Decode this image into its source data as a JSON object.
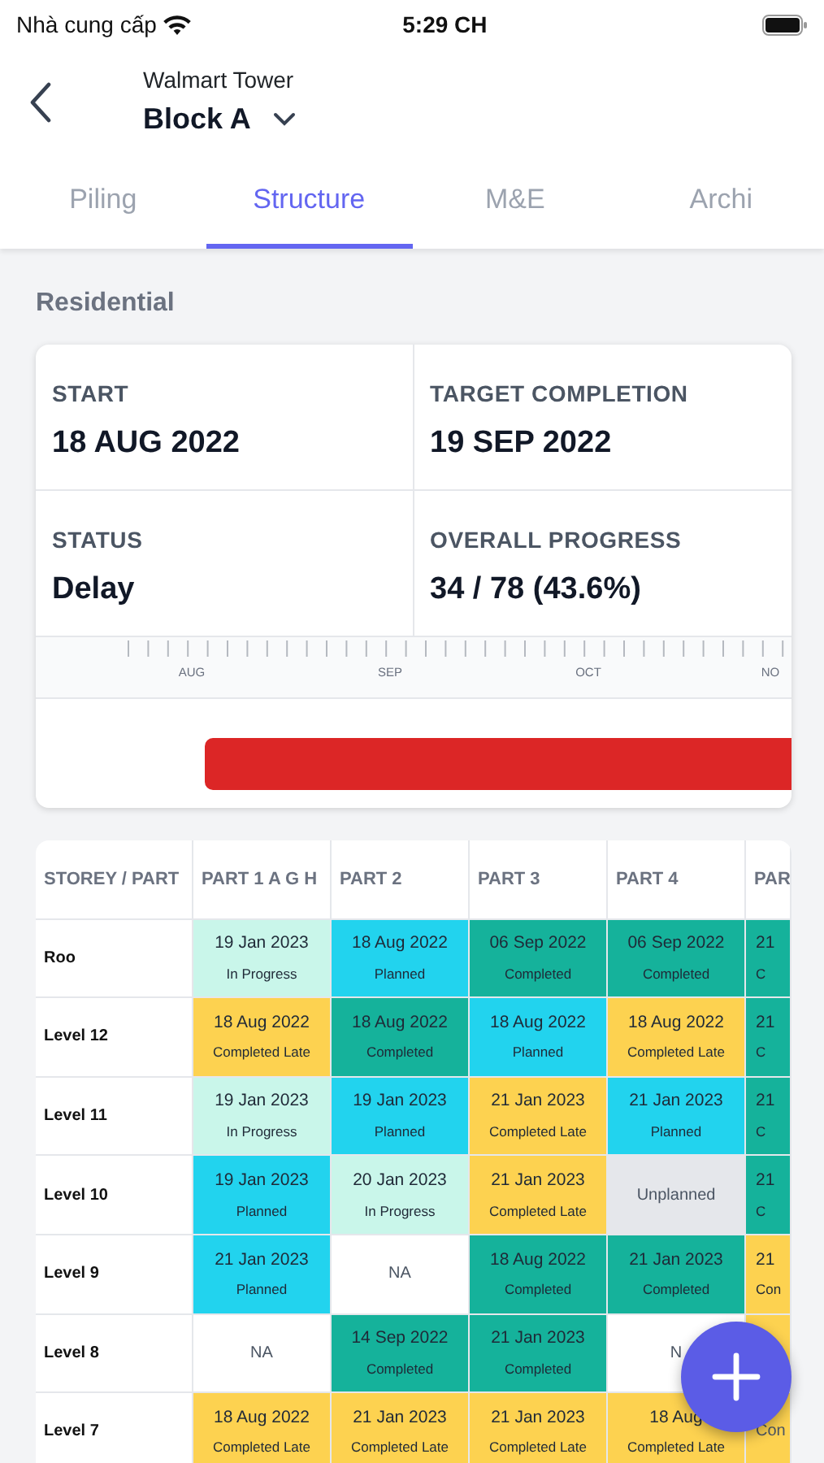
{
  "status_bar": {
    "carrier": "Nhà cung cấp",
    "time": "5:29 CH"
  },
  "header": {
    "project": "Walmart Tower",
    "block": "Block A"
  },
  "tabs": [
    {
      "label": "Piling",
      "selected": false
    },
    {
      "label": "Structure",
      "selected": true
    },
    {
      "label": "M&E",
      "selected": false
    },
    {
      "label": "Archi",
      "selected": false
    }
  ],
  "section_title": "Residential",
  "summary": [
    {
      "label": "START",
      "value": "18 AUG 2022"
    },
    {
      "label": "TARGET COMPLETION",
      "value": "19 SEP 2022"
    },
    {
      "label": "STATUS",
      "value": "Delay"
    },
    {
      "label": "OVERALL PROGRESS",
      "value": "34 / 78 (43.6%)"
    }
  ],
  "timeline": {
    "months": [
      "AUG",
      "SEP",
      "OCT",
      "NO"
    ]
  },
  "table": {
    "columns": [
      "STOREY / PART",
      "PART 1 A G H",
      "PART 2",
      "PART 3",
      "PART 4",
      "PAR"
    ],
    "rows": [
      {
        "cells": [
          {
            "kind": "storey",
            "label": "Roo"
          },
          {
            "kind": "in_progress",
            "date": "19 Jan 2023",
            "status": "In Progress"
          },
          {
            "kind": "planned",
            "date": "18 Aug 2022",
            "status": "Planned"
          },
          {
            "kind": "completed",
            "date": "06 Sep 2022",
            "status": "Completed"
          },
          {
            "kind": "completed",
            "date": "06 Sep 2022",
            "status": "Completed"
          },
          {
            "kind": "completed",
            "date": "21",
            "status": "C"
          }
        ]
      },
      {
        "cells": [
          {
            "kind": "storey",
            "label": "Level 12"
          },
          {
            "kind": "late",
            "date": "18 Aug 2022",
            "status": "Completed Late"
          },
          {
            "kind": "completed",
            "date": "18 Aug 2022",
            "status": "Completed"
          },
          {
            "kind": "planned",
            "date": "18 Aug 2022",
            "status": "Planned"
          },
          {
            "kind": "late",
            "date": "18 Aug 2022",
            "status": "Completed Late"
          },
          {
            "kind": "completed",
            "date": "21",
            "status": "C"
          }
        ]
      },
      {
        "cells": [
          {
            "kind": "storey",
            "label": "Level 11"
          },
          {
            "kind": "in_progress",
            "date": "19 Jan 2023",
            "status": "In Progress"
          },
          {
            "kind": "planned",
            "date": "19 Jan 2023",
            "status": "Planned"
          },
          {
            "kind": "late",
            "date": "21 Jan 2023",
            "status": "Completed Late"
          },
          {
            "kind": "planned",
            "date": "21 Jan 2023",
            "status": "Planned"
          },
          {
            "kind": "completed",
            "date": "21",
            "status": "C"
          }
        ]
      },
      {
        "cells": [
          {
            "kind": "storey",
            "label": "Level 10"
          },
          {
            "kind": "planned",
            "date": "19 Jan 2023",
            "status": "Planned"
          },
          {
            "kind": "in_progress",
            "date": "20 Jan 2023",
            "status": "In Progress"
          },
          {
            "kind": "late",
            "date": "21 Jan 2023",
            "status": "Completed Late"
          },
          {
            "kind": "unplanned",
            "status": "Unplanned"
          },
          {
            "kind": "completed",
            "date": "21",
            "status": "C"
          }
        ]
      },
      {
        "cells": [
          {
            "kind": "storey",
            "label": "Level 9"
          },
          {
            "kind": "planned",
            "date": "21 Jan 2023",
            "status": "Planned"
          },
          {
            "kind": "na",
            "status": "NA"
          },
          {
            "kind": "completed",
            "date": "18 Aug 2022",
            "status": "Completed"
          },
          {
            "kind": "completed",
            "date": "21 Jan 2023",
            "status": "Completed"
          },
          {
            "kind": "late",
            "date": "21",
            "status": "Con"
          }
        ]
      },
      {
        "cells": [
          {
            "kind": "storey",
            "label": "Level 8"
          },
          {
            "kind": "na",
            "status": "NA"
          },
          {
            "kind": "completed",
            "date": "14 Sep 2022",
            "status": "Completed"
          },
          {
            "kind": "completed",
            "date": "21 Jan 2023",
            "status": "Completed"
          },
          {
            "kind": "na",
            "status": "N"
          },
          {
            "kind": "late"
          }
        ]
      },
      {
        "cells": [
          {
            "kind": "storey",
            "label": "Level 7"
          },
          {
            "kind": "late",
            "date": "18 Aug 2022",
            "status": "Completed Late"
          },
          {
            "kind": "late",
            "date": "21 Jan 2023",
            "status": "Completed Late"
          },
          {
            "kind": "late",
            "date": "21 Jan 2023",
            "status": "Completed Late"
          },
          {
            "kind": "late",
            "date": "18 Aug",
            "status": "Completed Late"
          },
          {
            "kind": "late",
            "status": "Con"
          }
        ]
      }
    ]
  }
}
